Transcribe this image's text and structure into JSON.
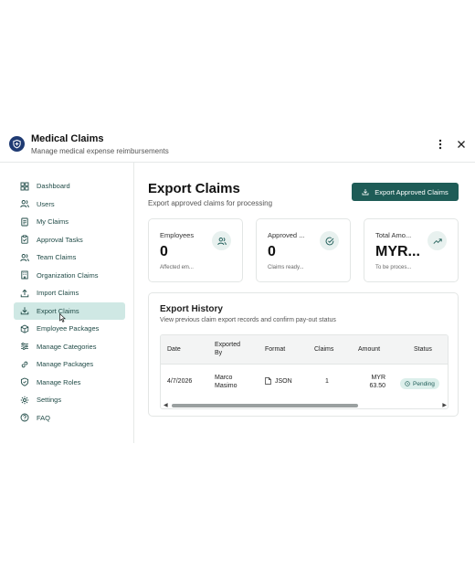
{
  "header": {
    "title": "Medical Claims",
    "subtitle": "Manage medical expense reimbursements",
    "menu_icon": "kebab-icon",
    "close_icon": "close-icon"
  },
  "sidebar": {
    "items": [
      {
        "label": "Dashboard",
        "icon": "grid-icon",
        "active": false
      },
      {
        "label": "Users",
        "icon": "users-icon",
        "active": false
      },
      {
        "label": "My Claims",
        "icon": "document-icon",
        "active": false
      },
      {
        "label": "Approval Tasks",
        "icon": "clipboard-check-icon",
        "active": false
      },
      {
        "label": "Team Claims",
        "icon": "users-icon",
        "active": false
      },
      {
        "label": "Organization Claims",
        "icon": "building-icon",
        "active": false
      },
      {
        "label": "Import Claims",
        "icon": "upload-icon",
        "active": false
      },
      {
        "label": "Export Claims",
        "icon": "download-icon",
        "active": true
      },
      {
        "label": "Employee Packages",
        "icon": "package-icon",
        "active": false
      },
      {
        "label": "Manage Categories",
        "icon": "sliders-icon",
        "active": false
      },
      {
        "label": "Manage Packages",
        "icon": "link-icon",
        "active": false
      },
      {
        "label": "Manage Roles",
        "icon": "shield-icon",
        "active": false
      },
      {
        "label": "Settings",
        "icon": "gear-icon",
        "active": false
      },
      {
        "label": "FAQ",
        "icon": "question-icon",
        "active": false
      }
    ]
  },
  "main": {
    "title": "Export Claims",
    "subtitle": "Export approved claims for processing",
    "export_button": "Export Approved Claims",
    "cards": [
      {
        "label": "Employees",
        "value": "0",
        "sub": "Affected em...",
        "icon": "users-icon"
      },
      {
        "label": "Approved ...",
        "value": "0",
        "sub": "Claims ready...",
        "icon": "check-circle-icon"
      },
      {
        "label": "Total Amo...",
        "value": "MYR...",
        "sub": "To be proces...",
        "icon": "trend-up-icon"
      }
    ],
    "history": {
      "title": "Export History",
      "subtitle": "View previous claim export records and confirm pay-out status",
      "columns": [
        "Date",
        "Exported By",
        "Format",
        "Claims",
        "Amount",
        "Status"
      ],
      "rows": [
        {
          "date": "4/7/2026",
          "exported_by": "Marco Masimo",
          "format": "JSON",
          "claims": "1",
          "amount": "MYR 63.50",
          "status": "Pending"
        }
      ]
    }
  },
  "colors": {
    "accent": "#1e5c57",
    "active_bg": "#cfe8e4",
    "badge_bg": "#dcefeb",
    "logo": "#1f3b73"
  }
}
